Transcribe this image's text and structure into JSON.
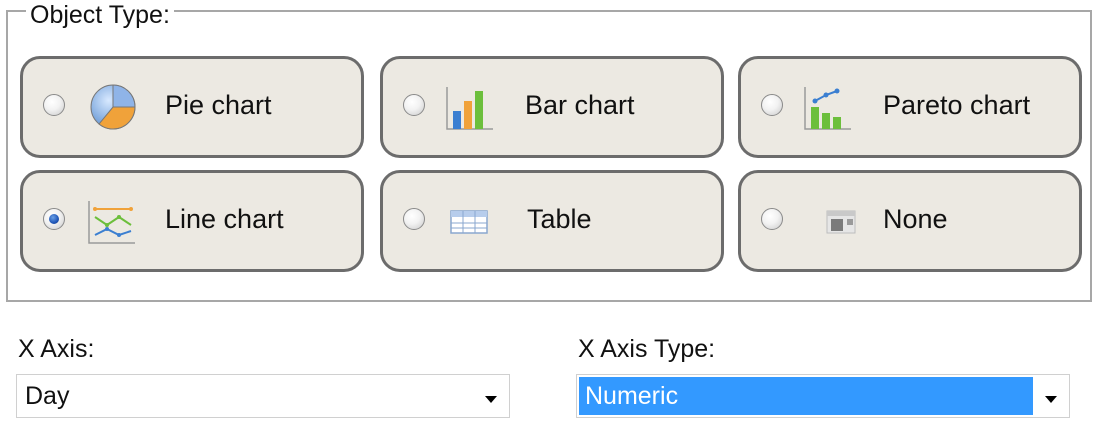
{
  "object_type": {
    "legend": "Object Type:",
    "options": [
      {
        "label": "Pie chart",
        "icon": "pie-chart-icon",
        "checked": false
      },
      {
        "label": "Bar chart",
        "icon": "bar-chart-icon",
        "checked": false
      },
      {
        "label": "Pareto chart",
        "icon": "pareto-chart-icon",
        "checked": false
      },
      {
        "label": "Line chart",
        "icon": "line-chart-icon",
        "checked": true
      },
      {
        "label": "Table",
        "icon": "table-icon",
        "checked": false
      },
      {
        "label": "None",
        "icon": "none-icon",
        "checked": false
      }
    ]
  },
  "x_axis": {
    "label": "X Axis:",
    "value": "Day"
  },
  "x_axis_type": {
    "label": "X Axis Type:",
    "value": "Numeric"
  },
  "colors": {
    "selection": "#3399ff",
    "tile": "#ece9e2",
    "tile_border": "#6c6c6c"
  }
}
